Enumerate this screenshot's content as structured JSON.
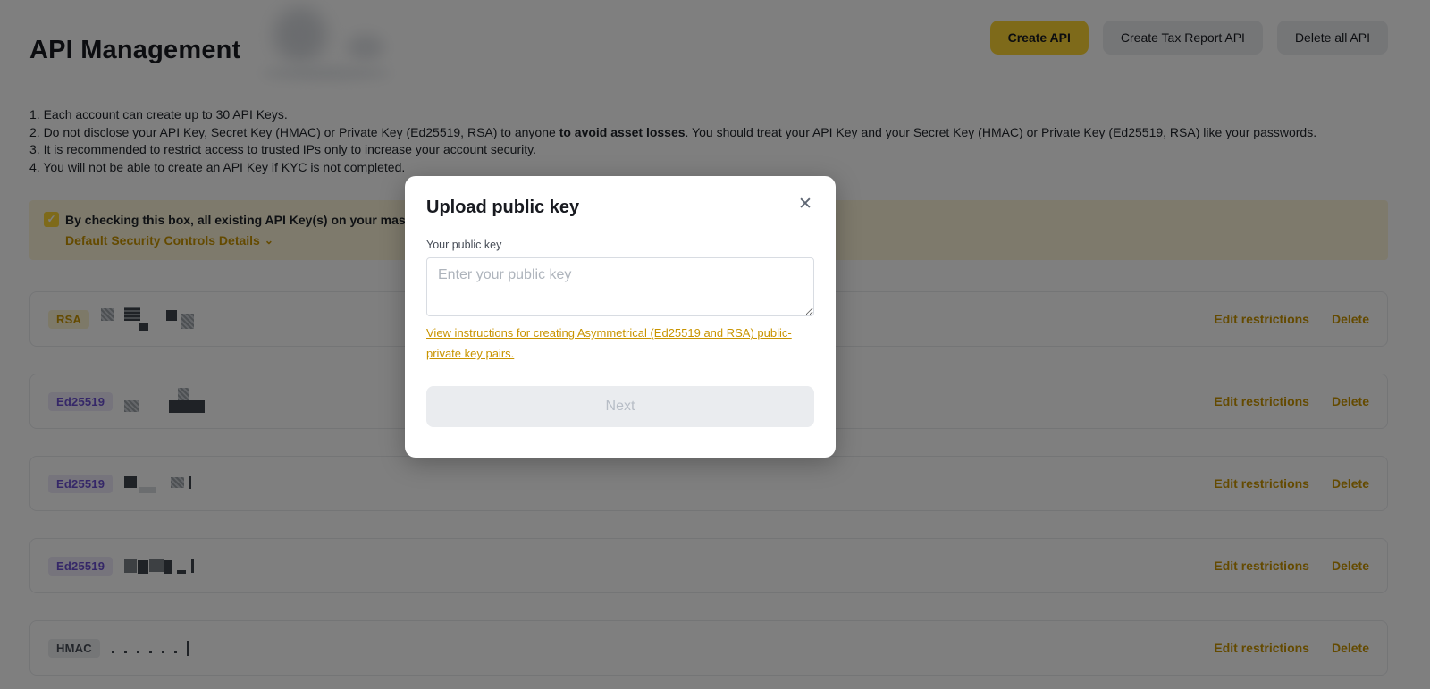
{
  "header": {
    "title": "API Management",
    "buttons": [
      {
        "label": "Create API",
        "style": "primary"
      },
      {
        "label": "Create Tax Report API",
        "style": "secondary"
      },
      {
        "label": "Delete all API",
        "style": "secondary"
      }
    ]
  },
  "instructions": [
    {
      "segments": [
        {
          "text": "1. Each account can create up to 30 API Keys.",
          "bold": false
        }
      ]
    },
    {
      "segments": [
        {
          "text": "2. Do not disclose your API Key, Secret Key (HMAC) or Private Key (Ed25519, RSA) to anyone ",
          "bold": false
        },
        {
          "text": "to avoid asset losses",
          "bold": true
        },
        {
          "text": ". You should treat your API Key and your Secret Key (HMAC) or Private Key (Ed25519, RSA) like your passwords.",
          "bold": false
        }
      ]
    },
    {
      "segments": [
        {
          "text": "3. It is recommended to restrict access to trusted IPs only to increase your account security.",
          "bold": false
        }
      ]
    },
    {
      "segments": [
        {
          "text": "4. You will not be able to create an API Key if KYC is not completed.",
          "bold": false
        }
      ]
    }
  ],
  "banner": {
    "checkbox_checked": true,
    "check_icon": "✓",
    "text": "By checking this box, all existing API Key(s) on your master a",
    "link_label": "Default Security Controls Details",
    "chevron_icon": "⌄"
  },
  "api_keys": {
    "edit_label": "Edit restrictions",
    "delete_label": "Delete",
    "rows": [
      {
        "key_type": "RSA"
      },
      {
        "key_type": "Ed25519"
      },
      {
        "key_type": "Ed25519"
      },
      {
        "key_type": "Ed25519"
      },
      {
        "key_type": "HMAC"
      }
    ]
  },
  "modal": {
    "title": "Upload public key",
    "close_icon": "✕",
    "field_label": "Your public key",
    "input_value": "",
    "input_placeholder": "Enter your public key",
    "instructions_link": "View instructions for creating Asymmetrical (Ed25519 and RSA) public-private key pairs.",
    "next_label": "Next"
  },
  "colors": {
    "primary_yellow": "#FCD535",
    "link_gold": "#C99400",
    "banner_bg": "#FDF5D8",
    "badges": {
      "RSA": {
        "bg": "#FBF2D0",
        "fg": "#C99400"
      },
      "Ed25519": {
        "bg": "#EDE9F9",
        "fg": "#6A4FD0"
      },
      "HMAC": {
        "bg": "#EAECEF",
        "fg": "#474D57"
      }
    }
  }
}
